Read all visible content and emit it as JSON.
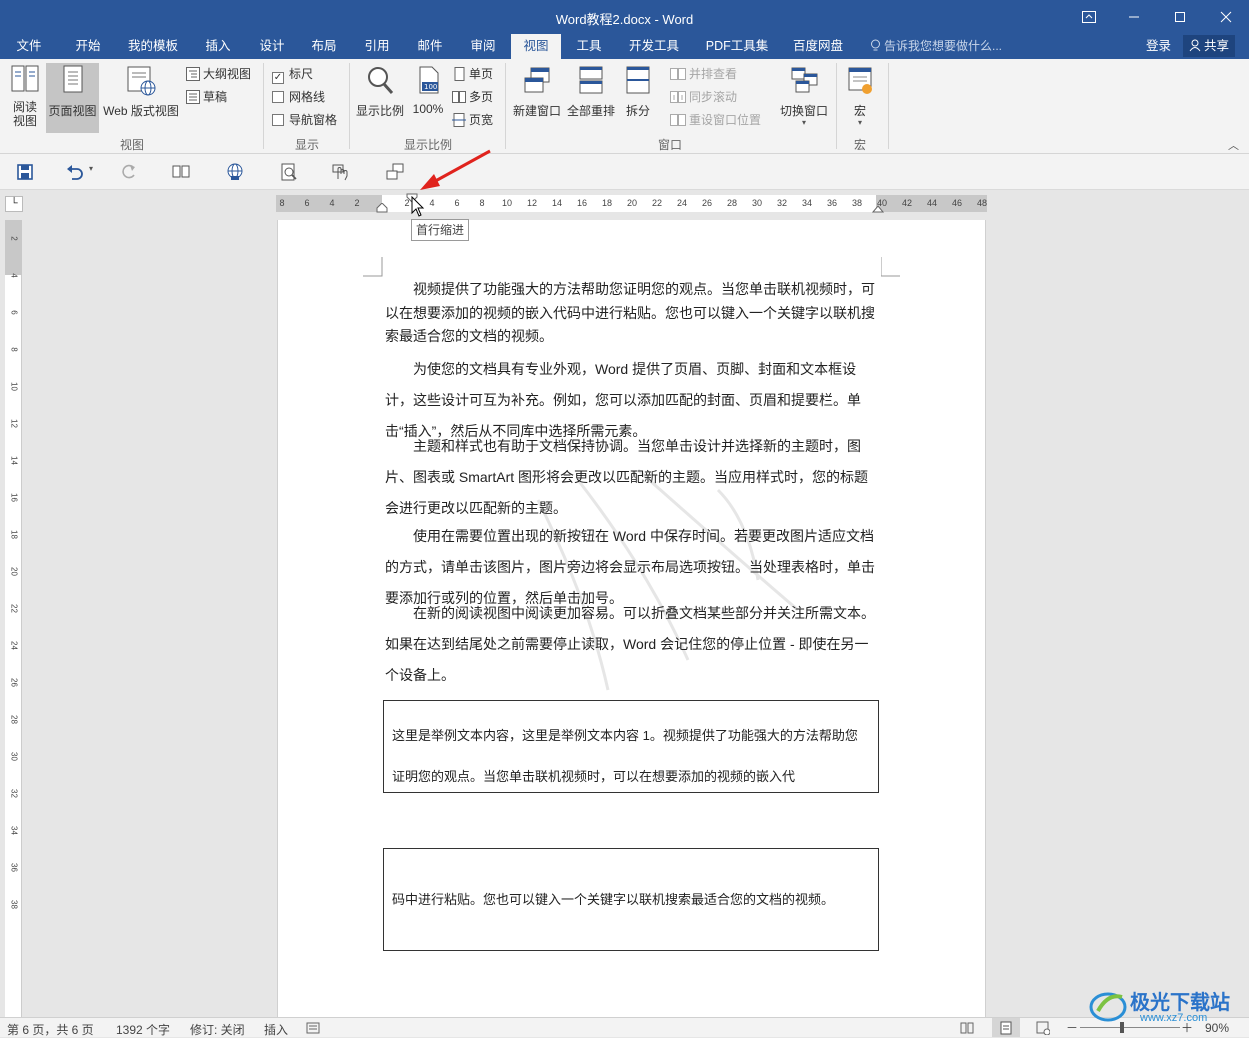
{
  "window": {
    "title": "Word教程2.docx - Word",
    "controls": [
      "restore-ribbon",
      "minimize",
      "maximize",
      "close"
    ]
  },
  "tabs": [
    "文件",
    "开始",
    "我的模板",
    "插入",
    "设计",
    "布局",
    "引用",
    "邮件",
    "审阅",
    "视图",
    "工具",
    "开发工具",
    "PDF工具集",
    "百度网盘"
  ],
  "active_tab": "视图",
  "tellme": "告诉我您想要做什么...",
  "account": {
    "login": "登录",
    "share": "共享"
  },
  "ribbon": {
    "view_group": {
      "label": "视图",
      "read_mode": "阅读\n视图",
      "print_layout": "页面视图",
      "web_layout": "Web 版式视图",
      "outline": "大纲视图",
      "draft": "草稿"
    },
    "show_group": {
      "label": "显示",
      "ruler": "标尺",
      "ruler_checked": true,
      "gridlines": "网格线",
      "gridlines_checked": false,
      "nav_pane": "导航窗格",
      "nav_pane_checked": false
    },
    "zoom_group": {
      "label": "显示比例",
      "zoom": "显示比例",
      "hundred": "100%",
      "one_page": "单页",
      "multi_page": "多页",
      "page_width": "页宽"
    },
    "window_group": {
      "label": "窗口",
      "new_window": "新建窗口",
      "arrange_all": "全部重排",
      "split": "拆分",
      "side_by_side": "并排查看",
      "sync_scroll": "同步滚动",
      "reset_pos": "重设窗口位置",
      "switch_windows": "切换窗口"
    },
    "macro_group": {
      "label": "宏",
      "macros": "宏"
    }
  },
  "ruler": {
    "left_numbers": [
      "8",
      "6",
      "4",
      "2"
    ],
    "right_numbers": [
      "2",
      "4",
      "6",
      "8",
      "10",
      "12",
      "14",
      "16",
      "18",
      "20",
      "22",
      "24",
      "26",
      "28",
      "30",
      "32",
      "34",
      "36",
      "38",
      "40",
      "42",
      "44",
      "46",
      "48"
    ],
    "tooltip": "首行缩进",
    "vertical_numbers": [
      "2",
      "4",
      "6",
      "8",
      "10",
      "12",
      "14",
      "16",
      "18",
      "20",
      "22",
      "24",
      "26",
      "28",
      "30",
      "32",
      "34",
      "36",
      "38"
    ]
  },
  "document": {
    "paragraphs": [
      "视频提供了功能强大的方法帮助您证明您的观点。当您单击联机视频时，可以在想要添加的视频的嵌入代码中进行粘贴。您也可以键入一个关键字以联机搜索最适合您的文档的视频。",
      "为使您的文档具有专业外观，Word 提供了页眉、页脚、封面和文本框设计，这些设计可互为补充。例如，您可以添加匹配的封面、页眉和提要栏。单击“插入”，然后从不同库中选择所需元素。",
      "主题和样式也有助于文档保持协调。当您单击设计并选择新的主题时，图片、图表或 SmartArt 图形将会更改以匹配新的主题。当应用样式时，您的标题会进行更改以匹配新的主题。",
      "使用在需要位置出现的新按钮在 Word 中保存时间。若要更改图片适应文档的方式，请单击该图片，图片旁边将会显示布局选项按钮。当处理表格时，单击要添加行或列的位置，然后单击加号。",
      "在新的阅读视图中阅读更加容易。可以折叠文档某些部分并关注所需文本。如果在达到结尾处之前需要停止读取，Word 会记住您的停止位置 - 即使在另一个设备上。"
    ],
    "box1": "这里是举例文本内容，这里是举例文本内容 1。视频提供了功能强大的方法帮助您证明您的观点。当您单击联机视频时，可以在想要添加的视频的嵌入代",
    "box2": "码中进行粘贴。您也可以键入一个关键字以联机搜索最适合您的文档的视频。"
  },
  "status": {
    "page": "第 6 页，共 6 页",
    "words": "1392 个字",
    "track": "修订: 关闭",
    "insert": "插入",
    "zoom": "90%"
  },
  "watermark": "极光下载站",
  "watermark_url": "www.xz7.com",
  "colors": {
    "word_blue": "#2b579a",
    "arrow_red": "#e0231d"
  }
}
